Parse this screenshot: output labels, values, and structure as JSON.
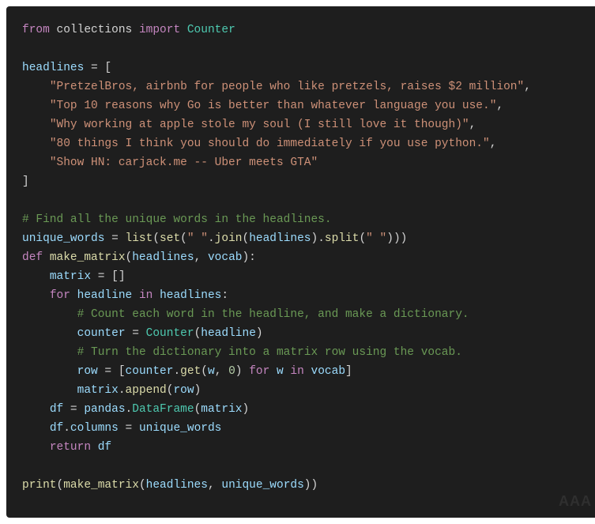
{
  "code": {
    "l1": {
      "kw1": "from",
      "mod": "collections",
      "kw2": "import",
      "cls": "Counter"
    },
    "l2": {
      "var": "headlines",
      "op": " = ["
    },
    "l3": {
      "str": "\"PretzelBros, airbnb for people who like pretzels, raises $2 million\""
    },
    "l4": {
      "str": "\"Top 10 reasons why Go is better than whatever language you use.\""
    },
    "l5": {
      "str": "\"Why working at apple stole my soul (I still love it though)\""
    },
    "l6": {
      "str": "\"80 things I think you should do immediately if you use python.\""
    },
    "l7": {
      "str": "\"Show HN: carjack.me -- Uber meets GTA\""
    },
    "l8": {
      "pn": "]"
    },
    "l9": {
      "cmt": "# Find all the unique words in the headlines."
    },
    "l10": {
      "var": "unique_words",
      "op": " = ",
      "fn1": "list",
      "pn1": "(",
      "fn2": "set",
      "pn2": "(",
      "str": "\" \"",
      "pn3": ".",
      "fn3": "join",
      "pn4": "(",
      "var2": "headlines",
      "pn5": ").",
      "fn4": "split",
      "pn6": "(",
      "str2": "\" \"",
      "pn7": ")))"
    },
    "l11": {
      "kw": "def",
      "fn": "make_matrix",
      "pn1": "(",
      "p1": "headlines",
      "c": ", ",
      "p2": "vocab",
      "pn2": "):"
    },
    "l12": {
      "var": "matrix",
      "op": " = []"
    },
    "l13": {
      "kw1": "for",
      "var1": "headline",
      "kw2": "in",
      "var2": "headlines",
      "pn": ":"
    },
    "l14": {
      "cmt": "# Count each word in the headline, and make a dictionary."
    },
    "l15": {
      "var": "counter",
      "op": " = ",
      "cls": "Counter",
      "pn1": "(",
      "arg": "headline",
      "pn2": ")"
    },
    "l16": {
      "cmt": "# Turn the dictionary into a matrix row using the vocab."
    },
    "l17": {
      "var": "row",
      "op": " = [",
      "obj": "counter",
      "pn1": ".",
      "fn": "get",
      "pn2": "(",
      "arg1": "w",
      "c": ", ",
      "num": "0",
      "pn3": ") ",
      "kw1": "for",
      "sp1": " ",
      "var2": "w",
      "sp2": " ",
      "kw2": "in",
      "sp3": " ",
      "var3": "vocab",
      "pn4": "]"
    },
    "l18": {
      "obj": "matrix",
      "pn1": ".",
      "fn": "append",
      "pn2": "(",
      "arg": "row",
      "pn3": ")"
    },
    "l19": {
      "var": "df",
      "op": " = ",
      "obj": "pandas",
      "pn1": ".",
      "cls": "DataFrame",
      "pn2": "(",
      "arg": "matrix",
      "pn3": ")"
    },
    "l20": {
      "obj": "df",
      "pn1": ".",
      "attr": "columns",
      "op": " = ",
      "var": "unique_words"
    },
    "l21": {
      "kw": "return",
      "sp": " ",
      "var": "df"
    },
    "l22": {
      "fn": "print",
      "pn1": "(",
      "fn2": "make_matrix",
      "pn2": "(",
      "arg1": "headlines",
      "c": ", ",
      "arg2": "unique_words",
      "pn3": "))"
    }
  },
  "watermark": "AAA"
}
